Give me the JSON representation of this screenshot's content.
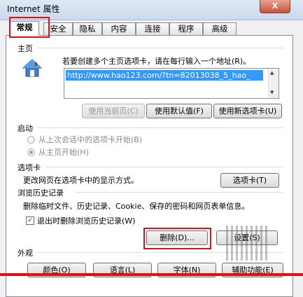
{
  "window": {
    "title": "Internet 属性",
    "close_label": "X"
  },
  "tabs": [
    {
      "label": "常规"
    },
    {
      "label": "安全"
    },
    {
      "label": "隐私"
    },
    {
      "label": "内容"
    },
    {
      "label": "连接"
    },
    {
      "label": "程序"
    },
    {
      "label": "高级"
    }
  ],
  "homepage": {
    "section_title": "主页",
    "instruction": "若要创建多个主页选项卡，请在每行输入一个地址(R)。",
    "url": "http://www.hao123.com/?tn=82013038_5_hao_",
    "use_current_label": "使用当前页(C)",
    "use_default_label": "使用默认值(F)",
    "use_new_tab_label": "使用新选项卡(U)"
  },
  "startup": {
    "section_title": "启动",
    "option1": "从上次会话中的选项卡开始(B)",
    "option2": "从主页开始(H)"
  },
  "tabs_section": {
    "section_title": "选项卡",
    "description": "更改网页在选项卡中的显示方式。",
    "button_label": "选项卡(T)"
  },
  "history": {
    "section_title": "浏览历史记录",
    "description": "删除临时文件、历史记录、Cookie、保存的密码和网页表单信息。",
    "checkbox_label": "退出时删除浏览历史记录(W)",
    "delete_label": "删除(D)...",
    "settings_label": "设置(S)"
  },
  "appearance": {
    "section_title": "外观",
    "color_label": "颜色(O)",
    "language_label": "语言(L)",
    "font_label": "字体(N)",
    "accessibility_label": "辅助功能(E)"
  }
}
